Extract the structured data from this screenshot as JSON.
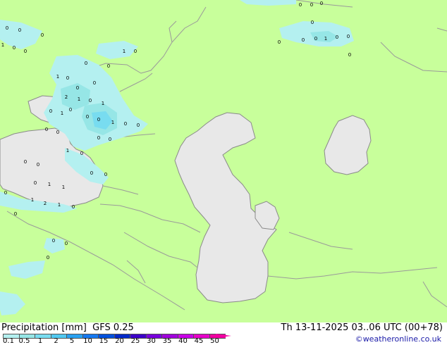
{
  "footer": {
    "title": "Precipitation [mm]  GFS 0.25",
    "datetime": "Th 13-11-2025 03..06 UTC (00+78)",
    "credit": "©weatheronline.co.uk"
  },
  "legend": {
    "ticks": [
      "0.1",
      "0.5",
      "1",
      "2",
      "5",
      "10",
      "15",
      "20",
      "25",
      "30",
      "35",
      "40",
      "45",
      "50"
    ],
    "colors": [
      "#b4f0f0",
      "#96e6e6",
      "#78dcf0",
      "#50c8f0",
      "#28a0f0",
      "#1478f0",
      "#0050dc",
      "#0028c8",
      "#3c00c8",
      "#7800dc",
      "#a000dc",
      "#c800e6",
      "#e600c8",
      "#f000a0"
    ]
  },
  "map": {
    "land_color": "#c8ff9b",
    "water_color": "#e8e8e8",
    "precip_light": "#b4f0f0",
    "precip_medium": "#96e6e6",
    "precip_heavy": "#78dcf0",
    "labels": [
      "0",
      "0",
      "0",
      "0",
      "0",
      "0",
      "0",
      "1",
      "0",
      "0",
      "0",
      "0",
      "0",
      "0",
      "1",
      "0",
      "1",
      "0",
      "0",
      "0",
      "0",
      "1",
      "2",
      "1",
      "0",
      "1",
      "0",
      "0",
      "0",
      "0",
      "0",
      "0",
      "0",
      "1",
      "1",
      "0",
      "0",
      "0",
      "0",
      "0",
      "1",
      "0",
      "0",
      "1",
      "2",
      "1",
      "0",
      "0",
      "0",
      "0",
      "0",
      "0",
      "1",
      "1",
      "0",
      "0",
      "0",
      "0",
      "0"
    ]
  }
}
